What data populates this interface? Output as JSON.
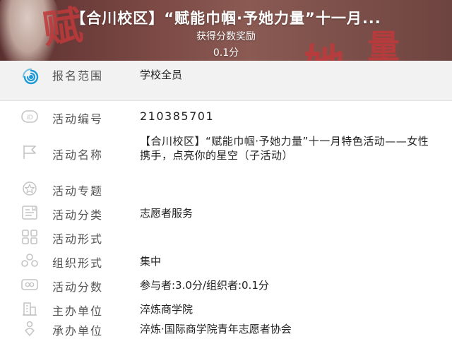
{
  "header": {
    "title": "【合川校区】“赋能巾帼·予她力量”十一月...",
    "reward_label": "获得分数奖励",
    "reward_value": "0.1分",
    "accent_color": "#c0393b"
  },
  "scope": {
    "icon": "radar-icon",
    "label": "报名范围",
    "value": "学校全员"
  },
  "details": {
    "activity_id": {
      "icon": "id-icon",
      "label": "活动编号",
      "value": "210385701"
    },
    "activity_name": {
      "icon": "flag-icon",
      "label": "活动名称",
      "value": "【合川校区】“赋能巾帼·予她力量”十一月特色活动——女性携手，点亮你的星空（子活动）"
    },
    "activity_topic": {
      "icon": "star-icon",
      "label": "活动专题",
      "value": ""
    },
    "activity_category": {
      "icon": "category-icon",
      "label": "活动分类",
      "value": "志愿者服务"
    },
    "activity_format": {
      "icon": "grid-icon",
      "label": "活动形式",
      "value": ""
    },
    "organization_form": {
      "icon": "people-icon",
      "label": "组织形式",
      "value": "集中"
    },
    "activity_score": {
      "icon": "score-icon",
      "label": "活动分数",
      "value": "参与者:3.0分/组织者:0.1分"
    },
    "host_unit": {
      "icon": "building-icon",
      "label": "主办单位",
      "value": "淬炼商学院"
    },
    "organizer_unit": {
      "icon": "person-icon",
      "label": "承办单位",
      "value": "淬炼·国际商学院青年志愿者协会"
    }
  }
}
